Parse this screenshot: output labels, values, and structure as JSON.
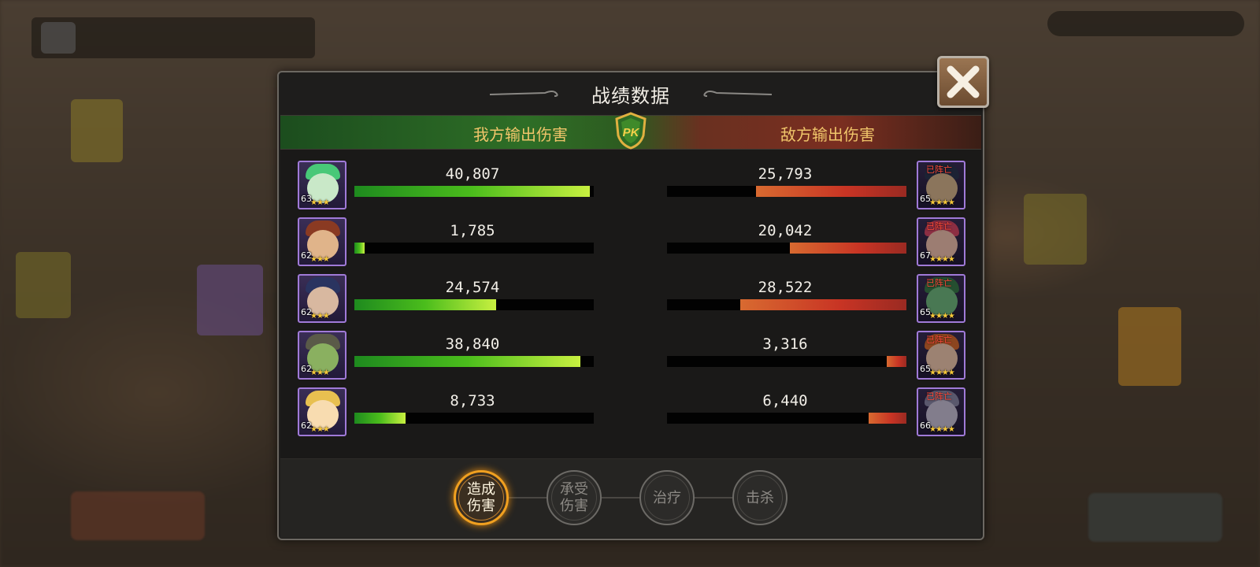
{
  "dialog": {
    "title": "战绩数据",
    "left_header": "我方输出伤害",
    "right_header": "敌方输出伤害",
    "badge_text": "PK"
  },
  "colors": {
    "ally_bar_start": "#1e8a1e",
    "ally_bar_end": "#c8f040",
    "enemy_bar_start": "#d86a30",
    "enemy_bar_end": "#9a2a22",
    "header_text": "#f0c56a",
    "active_tab_ring": "#f0a020",
    "portrait_border": "#a07ad8"
  },
  "rows": [
    {
      "ally": {
        "level": "63",
        "stars": "★★★",
        "damage": "40,807",
        "fill": 0.985,
        "face": "#c9e8c8",
        "hair": "#48c878"
      },
      "enemy": {
        "level": "65",
        "stars": "★★★★",
        "status": "已阵亡",
        "damage": "25,793",
        "fill": 0.627,
        "face": "#d6b48e",
        "hair": "#2b3550"
      }
    },
    {
      "ally": {
        "level": "62",
        "stars": "★★★",
        "damage": "1,785",
        "fill": 0.043,
        "face": "#e0b48a",
        "hair": "#8a3a22"
      },
      "enemy": {
        "level": "67",
        "stars": "★★★★",
        "status": "已阵亡",
        "damage": "20,042",
        "fill": 0.487,
        "face": "#f0c0b0",
        "hair": "#d84868"
      }
    },
    {
      "ally": {
        "level": "62",
        "stars": "★★★",
        "damage": "24,574",
        "fill": 0.593,
        "face": "#d8b8a0",
        "hair": "#2a3460"
      },
      "enemy": {
        "level": "65",
        "stars": "★★★★",
        "status": "已阵亡",
        "damage": "28,522",
        "fill": 0.693,
        "face": "#70b880",
        "hair": "#3a7a4a"
      }
    },
    {
      "ally": {
        "level": "62",
        "stars": "★★★",
        "damage": "38,840",
        "fill": 0.943,
        "face": "#8ab060",
        "hair": "#5a5a48"
      },
      "enemy": {
        "level": "65",
        "stars": "★★★★",
        "status": "已阵亡",
        "damage": "3,316",
        "fill": 0.083,
        "face": "#f0c8b0",
        "hair": "#d86a30"
      }
    },
    {
      "ally": {
        "level": "62",
        "stars": "★★★",
        "damage": "8,733",
        "fill": 0.213,
        "face": "#f8dcb0",
        "hair": "#e8c050"
      },
      "enemy": {
        "level": "66",
        "stars": "★★★★",
        "status": "已阵亡",
        "damage": "6,440",
        "fill": 0.157,
        "face": "#c8c0d8",
        "hair": "#8a88a8"
      }
    }
  ],
  "tabs": [
    {
      "label": "造成\n伤害",
      "active": true
    },
    {
      "label": "承受\n伤害",
      "active": false
    },
    {
      "label": "治疗",
      "active": false
    },
    {
      "label": "击杀",
      "active": false
    }
  ],
  "icons": {
    "close": "close-icon",
    "badge": "pk-badge-icon"
  }
}
